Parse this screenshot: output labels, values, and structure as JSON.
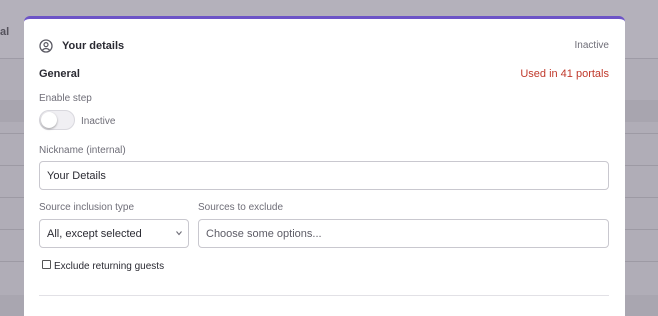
{
  "background": {
    "crumb_fragment": "al"
  },
  "modal": {
    "title": "Your details",
    "status": "Inactive",
    "section_title": "General",
    "used_in": "Used in 41 portals",
    "enable_step": {
      "label": "Enable step",
      "state_text": "Inactive",
      "enabled": false
    },
    "nickname": {
      "label": "Nickname (internal)",
      "value": "Your Details"
    },
    "source_inclusion": {
      "label": "Source inclusion type",
      "value": "All, except selected"
    },
    "sources_exclude": {
      "label": "Sources to exclude",
      "placeholder": "Choose some options..."
    },
    "exclude_returning": {
      "label": "Exclude returning guests",
      "checked": false
    }
  },
  "colors": {
    "accent": "#6d54c7",
    "used_in": "#c0392b"
  },
  "icons": {
    "title_icon": "user-circle-icon",
    "select_icon": "chevron-down-icon"
  }
}
